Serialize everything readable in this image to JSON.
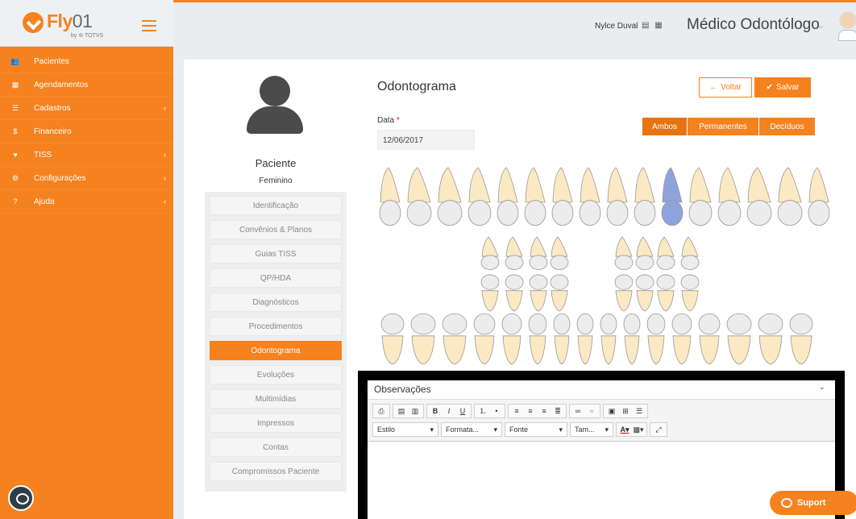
{
  "app": {
    "logo_brand": "Fly",
    "logo_number": "01",
    "logo_sub": "by ⊚ TOTVS"
  },
  "sidebar": {
    "items": [
      {
        "label": "Pacientes",
        "icon": "users-icon",
        "glyph": "👥",
        "chevron": false
      },
      {
        "label": "Agendamentos",
        "icon": "calendar-icon",
        "glyph": "▦",
        "chevron": false
      },
      {
        "label": "Cadastros",
        "icon": "list-icon",
        "glyph": "☰",
        "chevron": true
      },
      {
        "label": "Financeiro",
        "icon": "dollar-icon",
        "glyph": "$",
        "chevron": false
      },
      {
        "label": "TISS",
        "icon": "heartbeat-icon",
        "glyph": "♥",
        "chevron": true
      },
      {
        "label": "Configurações",
        "icon": "gear-icon",
        "glyph": "⚙",
        "chevron": true
      },
      {
        "label": "Ajuda",
        "icon": "question-icon",
        "glyph": "?",
        "chevron": true
      }
    ]
  },
  "header": {
    "user_name": "Nylce Duval",
    "role": "Médico Odontólogo"
  },
  "patient": {
    "name": "Paciente",
    "gender": "Feminino"
  },
  "patient_menu": [
    "Identificação",
    "Convênios & Planos",
    "Guias TISS",
    "QP/HDA",
    "Diagnósticos",
    "Procedimentos",
    "Odontograma",
    "Evoluções",
    "Multimídias",
    "Impressos",
    "Contas",
    "Compromissos Paciente"
  ],
  "patient_menu_active": "Odontograma",
  "main": {
    "title": "Odontograma",
    "btn_back": "Voltar",
    "btn_save": "Salvar",
    "date_label": "Data",
    "date_required": "*",
    "date_value": "12/06/2017",
    "segments": [
      "Ambos",
      "Permanentes",
      "Decíduos"
    ],
    "segment_active": "Ambos"
  },
  "observations": {
    "title": "Observações",
    "toolbar_selects": [
      "Estilo",
      "Formata...",
      "Fonte",
      "Tam..."
    ]
  },
  "support": {
    "label": "Suport"
  },
  "colors": {
    "accent": "#f5821f",
    "tooth": "#fbe9c3",
    "tooth_selected": "#8ea3dd"
  }
}
